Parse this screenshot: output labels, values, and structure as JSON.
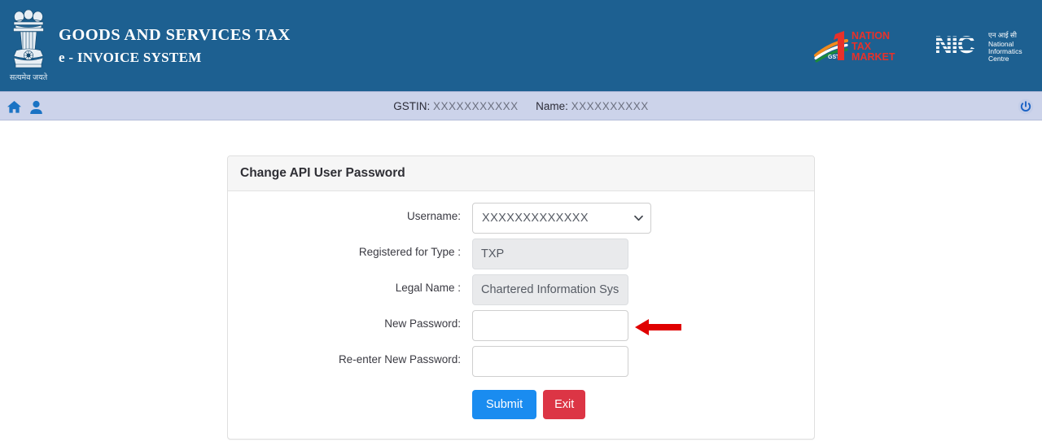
{
  "header": {
    "emblem_caption": "सत्यमेव जयते",
    "title_main": "GOODS AND SERVICES TAX",
    "title_sub": "e - INVOICE SYSTEM",
    "bg_color": "#1d6091",
    "logo_ntm": {
      "line1": "NATION",
      "line2": "TAX",
      "line3": "MARKET",
      "numeral": "1",
      "badge": "GST",
      "color": "#e8312a"
    },
    "logo_nic": {
      "mark": "NIC",
      "hindi": "एन आई सी",
      "line1": "National",
      "line2": "Informatics",
      "line3": "Centre"
    }
  },
  "navbar": {
    "bg_color": "#ccd3ea",
    "home_icon": "home-icon",
    "user_icon": "user-icon",
    "power_icon": "power-icon",
    "gstin_label": "GSTIN:",
    "gstin_value": "XXXXXXXXXXX",
    "name_label": "Name:",
    "name_value": "XXXXXXXXXX"
  },
  "panel": {
    "title": "Change API User Password"
  },
  "form": {
    "username": {
      "label": "Username:",
      "value": "XXXXXXXXXXXXX",
      "options": [
        "XXXXXXXXXXXXX"
      ]
    },
    "registered_for_type": {
      "label": "Registered for Type :",
      "value": "TXP",
      "readonly": true
    },
    "legal_name": {
      "label": "Legal Name :",
      "value": "Chartered Information Sys",
      "readonly": true
    },
    "new_password": {
      "label": "New Password:",
      "value": "",
      "placeholder": ""
    },
    "reenter_new_password": {
      "label": "Re-enter New Password:",
      "value": "",
      "placeholder": ""
    }
  },
  "buttons": {
    "submit_label": "Submit",
    "submit_color": "#1a8cf0",
    "exit_label": "Exit",
    "exit_color": "#dc3545"
  },
  "annotation": {
    "arrow_color": "#e00000",
    "points_to": "new-password-input"
  }
}
